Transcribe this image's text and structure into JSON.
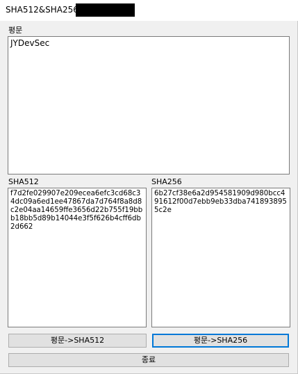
{
  "window": {
    "title": "SHA512&SHA256"
  },
  "plaintext": {
    "label": "평문",
    "value": "JYDevSec"
  },
  "sha512": {
    "label": "SHA512",
    "value": "f7d2fe029907e209ecea6efc3cd68c34dc09a6ed1ee47867da7d764f8a8d8c2e04aa14659ffe3656d22b755f19bbb18bb5d89b14044e3f5f626b4cff6db2d662"
  },
  "sha256": {
    "label": "SHA256",
    "value": "6b27cf38e6a2d954581909d980bcc491612f00d7ebb9eb33dba7418938955c2e"
  },
  "buttons": {
    "to_sha512": "평문->SHA512",
    "to_sha256": "평문->SHA256",
    "exit": "종료"
  }
}
